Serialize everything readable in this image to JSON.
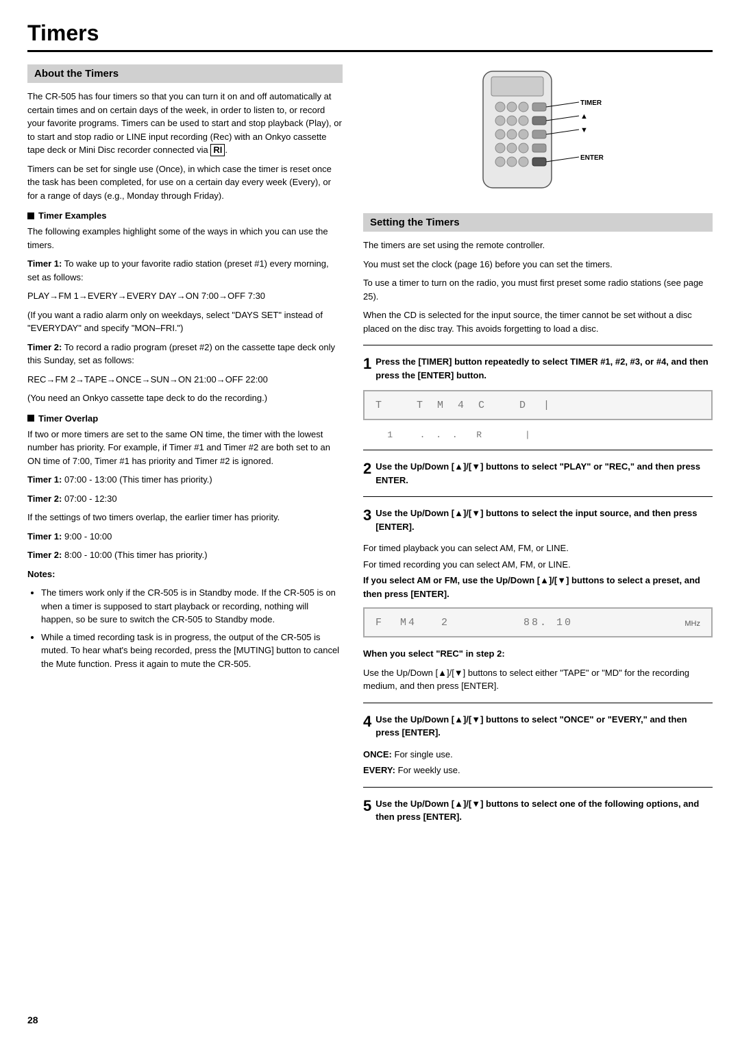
{
  "page": {
    "title": "Timers",
    "page_number": "28"
  },
  "left_column": {
    "section_title": "About the Timers",
    "intro_paragraphs": [
      "The CR-505 has four timers so that you can turn it on and off automatically at certain times and on certain days of the week, in order to listen to, or record your favorite programs. Timers can be used to start and stop playback (Play), or to start and stop radio or LINE input recording (Rec) with an Onkyo cassette tape deck or Mini Disc recorder connected via RI.",
      "Timers can be set for single use (Once), in which case the timer is reset once the task has been completed, for use on a certain day every week (Every), or for a range of days (e.g., Monday through Friday)."
    ],
    "subsection1": {
      "title": "Timer Examples",
      "intro": "The following examples highlight some of the ways in which you can use the timers.",
      "timer1_label": "Timer 1:",
      "timer1_text": "To wake up to your favorite radio station (preset #1) every morning, set as follows:",
      "timer1_sequence": "PLAY→FM 1→EVERY→EVERY DAY→ON 7:00→OFF 7:30",
      "timer1_note": "(If you want a radio alarm only on weekdays, select \"DAYS SET\" instead of \"EVERYDAY\" and specify \"MON–FRI.\")",
      "timer2_label": "Timer 2:",
      "timer2_text": "To record a radio program (preset #2) on the cassette tape deck only this Sunday, set as follows:",
      "timer2_sequence": "REC→FM 2→TAPE→ONCE→SUN→ON 21:00→OFF 22:00",
      "timer2_note": "(You need an Onkyo cassette tape deck to do the recording.)"
    },
    "subsection2": {
      "title": "Timer Overlap",
      "intro": "If two or more timers are set to the same ON time, the timer with the lowest number has priority. For example, if Timer #1 and Timer #2 are both set to an ON time of 7:00, Timer #1 has priority and Timer #2 is ignored.",
      "timer1_label": "Timer 1:",
      "timer1_text": "07:00 - 13:00 (This timer has priority.)",
      "timer2_label": "Timer 2:",
      "timer2_text": "07:00 - 12:30",
      "overlap_note": "If the settings of two timers overlap, the earlier timer has priority.",
      "timer1b_label": "Timer 1:",
      "timer1b_text": "9:00 - 10:00",
      "timer2b_label": "Timer 2:",
      "timer2b_text": "8:00 - 10:00 (This timer has priority.)",
      "notes_label": "Notes:",
      "notes": [
        "The timers work only if the CR-505 is in Standby mode. If the CR-505 is on when a timer is supposed to start playback or recording, nothing will happen, so be sure to switch the CR-505 to Standby mode.",
        "While a timed recording task is in progress, the output of the CR-505 is muted. To hear what's being recorded, press the [MUTING] button to cancel the Mute function. Press it again to mute the CR-505."
      ]
    }
  },
  "right_column": {
    "remote_labels": {
      "timer": "TIMER",
      "up_arrow": "▲",
      "down_arrow": "▼",
      "enter": "ENTER"
    },
    "section_title": "Setting the Timers",
    "setting_paragraphs": [
      "The timers are set using the remote controller.",
      "You must set the clock (page 16) before you can set the timers.",
      "To use a timer to turn on the radio, you must first preset some radio stations (see page 25).",
      "When the CD is selected for the input source, the timer cannot be set without a disc placed on the disc tray. This avoids forgetting to load a disc."
    ],
    "step1": {
      "number": "1",
      "text": "Press the [TIMER] button repeatedly to select TIMER #1, #2, #3, or #4, and then press the [ENTER] button.",
      "display": "T  TM4C  D      |    1  ...  R    |"
    },
    "step2": {
      "number": "2",
      "text": "Use the Up/Down [▲]/[▼] buttons to select \"PLAY\" or \"REC,\" and then press ENTER."
    },
    "step3": {
      "number": "3",
      "text": "Use the Up/Down [▲]/[▼] buttons to select the input source, and then press [ENTER].",
      "sub1": "For timed playback you can select AM, FM, or LINE.",
      "sub2": "For timed recording you can select AM, FM, or LINE.",
      "sub3_bold": "If you select AM or FM, use the Up/Down [▲]/[▼] buttons to select a preset, and then press [ENTER].",
      "display": "F  M4  2        88. 10",
      "display_mhz": "MHz"
    },
    "step3_rec": {
      "title": "When you select \"REC\" in step 2:",
      "text": "Use the Up/Down [▲]/[▼] buttons to select either \"TAPE\" or \"MD\" for the recording medium, and then press [ENTER]."
    },
    "step4": {
      "number": "4",
      "text": "Use the Up/Down [▲]/[▼] buttons to select \"ONCE\" or \"EVERY,\" and then press [ENTER].",
      "once_label": "ONCE:",
      "once_text": "For single use.",
      "every_label": "EVERY:",
      "every_text": "For weekly use."
    },
    "step5": {
      "number": "5",
      "text": "Use the Up/Down [▲]/[▼] buttons to select one of the following options, and then press [ENTER].",
      "detected_text": "buttons to select"
    }
  }
}
